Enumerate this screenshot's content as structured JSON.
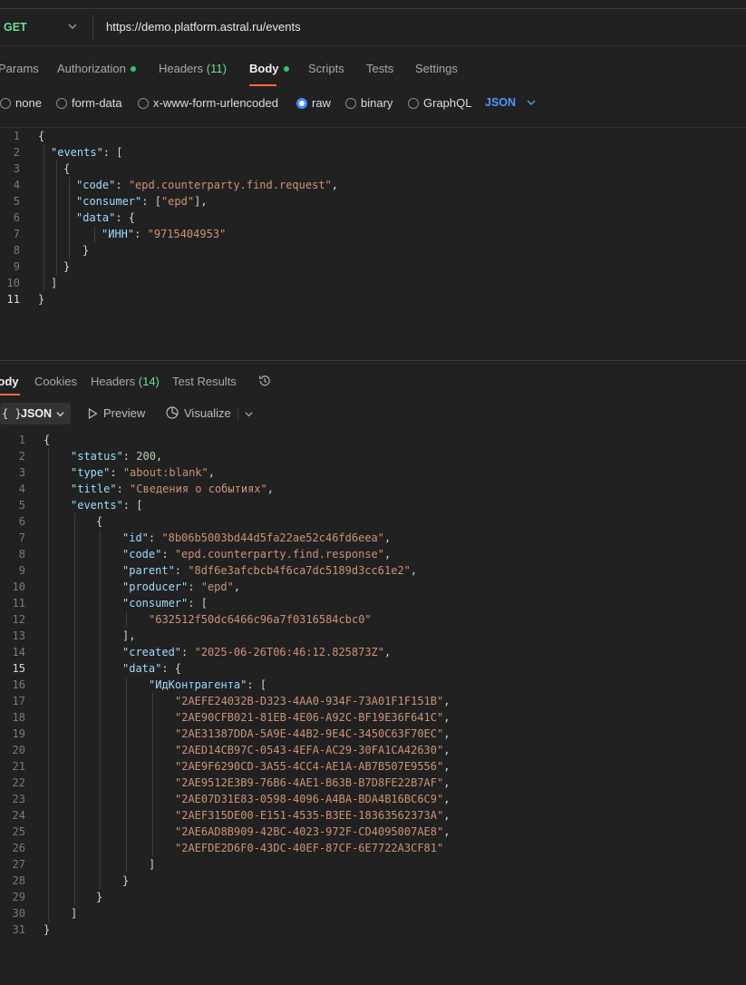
{
  "request": {
    "method": "GET",
    "url": "https://demo.platform.astral.ru/events",
    "tabs": [
      {
        "label": "Params"
      },
      {
        "label": "Authorization"
      },
      {
        "label": "Headers",
        "count": "(11)"
      },
      {
        "label": "Body"
      },
      {
        "label": "Scripts"
      },
      {
        "label": "Tests"
      },
      {
        "label": "Settings"
      }
    ],
    "body_types": [
      "none",
      "form-data",
      "x-www-form-urlencoded",
      "raw",
      "binary",
      "GraphQL"
    ],
    "selected_body_type": "raw",
    "raw_format": "JSON",
    "line_numbers": [
      "1",
      "2",
      "3",
      "4",
      "5",
      "6",
      "7",
      "8",
      "9",
      "10",
      "11"
    ]
  },
  "response": {
    "tabs": [
      {
        "label": "Body"
      },
      {
        "label": "Cookies"
      },
      {
        "label": "Headers",
        "count": "(14)"
      },
      {
        "label": "Test Results"
      }
    ],
    "format": "JSON",
    "format_braces": "{ }",
    "preview_label": "Preview",
    "visualize_label": "Visualize",
    "line_numbers": [
      "1",
      "2",
      "3",
      "4",
      "5",
      "6",
      "7",
      "8",
      "9",
      "10",
      "11",
      "12",
      "13",
      "14",
      "15",
      "16",
      "17",
      "18",
      "19",
      "20",
      "21",
      "22",
      "23",
      "24",
      "25",
      "26",
      "27",
      "28",
      "29",
      "30",
      "31"
    ]
  },
  "request_body_json": {
    "events": [
      {
        "code": "epd.counterparty.find.request",
        "consumer": [
          "epd"
        ],
        "data": {
          "ИНН": "9715404953"
        }
      }
    ]
  },
  "response_body_json": {
    "status": 200,
    "type": "about:blank",
    "title": "Сведения о событиях",
    "events": [
      {
        "id": "8b06b5003bd44d5fa22ae52c46fd6eea",
        "code": "epd.counterparty.find.response",
        "parent": "8df6e3afcbcb4f6ca7dc5189d3cc61e2",
        "producer": "epd",
        "consumer": [
          "632512f50dc6466c96a7f0316584cbc0"
        ],
        "created": "2025-06-26T06:46:12.825873Z",
        "data": {
          "ИдКонтрагента": [
            "2AEFE24032B-D323-4AA0-934F-73A01F1F151B",
            "2AE90CFB021-81EB-4E06-A92C-BF19E36F641C",
            "2AE31387DDA-5A9E-44B2-9E4C-3450C63F70EC",
            "2AED14CB97C-0543-4EFA-AC29-30FA1CA42630",
            "2AE9F6290CD-3A55-4CC4-AE1A-AB7B507E9556",
            "2AE9512E3B9-76B6-4AE1-B63B-B7D8FE22B7AF",
            "2AE07D31E83-0598-4096-A4BA-BDA4B16BC6C9",
            "2AEF315DE00-E151-4535-B3EE-18363562373A",
            "2AE6AD8B909-42BC-4023-972F-CD4095007AE8",
            "2AEFDE2D6F0-43DC-40EF-87CF-6E7722A3CF81"
          ]
        }
      }
    ]
  },
  "colors": {
    "background": "#212121",
    "accent": "#ff6c37",
    "method": "#6bdd9a",
    "json_selector": "#4c97ff",
    "radio_selected": "#3d8cff"
  },
  "icons": [
    "chevron-down-icon",
    "play-icon",
    "visualize-icon",
    "history-icon"
  ]
}
